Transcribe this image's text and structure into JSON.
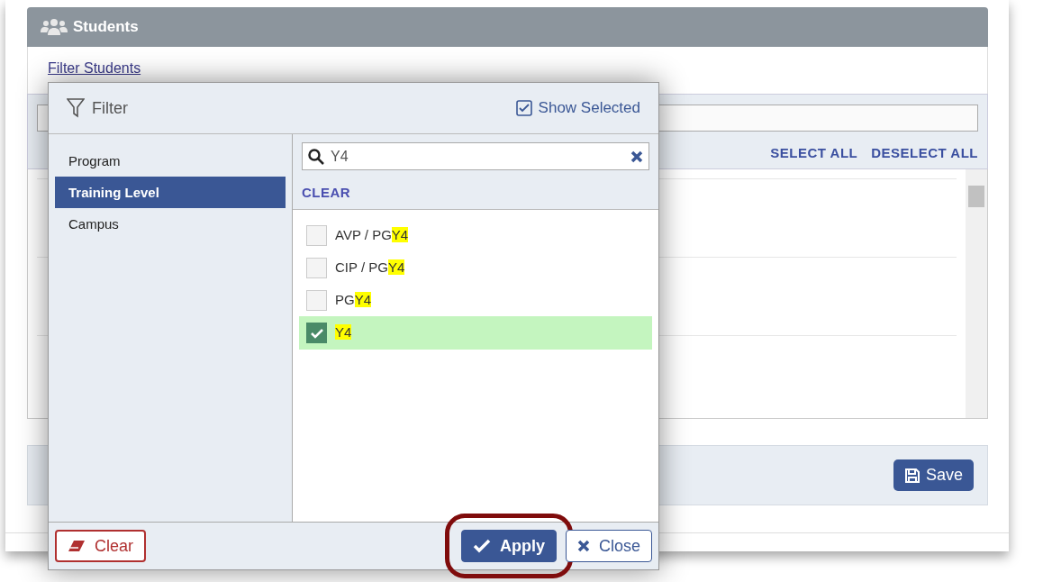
{
  "panel": {
    "title": "Students",
    "filter_link": "Filter Students",
    "actions": [
      "SELECT ALL",
      "DESELECT ALL"
    ],
    "save_button": "Save"
  },
  "filter_dialog": {
    "title": "Filter",
    "show_selected": {
      "label": "Show Selected",
      "checked": true
    },
    "categories": [
      {
        "label": "Program",
        "selected": false
      },
      {
        "label": "Training Level",
        "selected": true
      },
      {
        "label": "Campus",
        "selected": false
      }
    ],
    "search": {
      "value": "Y4"
    },
    "clear_link": "CLEAR",
    "options": [
      {
        "text": "AVP / PG",
        "match": "Y4",
        "checked": false
      },
      {
        "text": "CIP / PG",
        "match": "Y4",
        "checked": false
      },
      {
        "text": "PG",
        "match": "Y4",
        "checked": false
      },
      {
        "match": "Y4",
        "checked": true
      }
    ],
    "buttons": [
      {
        "kind": "clear",
        "label": "Clear",
        "highlighted": false
      },
      {
        "kind": "apply",
        "label": "Apply",
        "highlighted": true
      },
      {
        "kind": "close",
        "label": "Close",
        "highlighted": false
      }
    ]
  }
}
